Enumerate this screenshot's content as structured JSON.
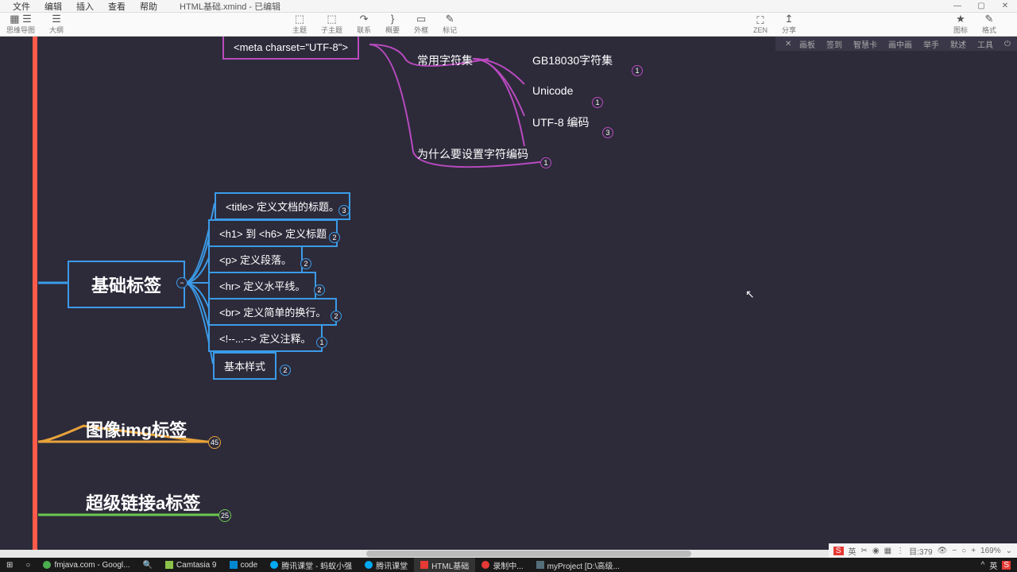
{
  "menu": [
    "文件",
    "编辑",
    "插入",
    "查看",
    "帮助"
  ],
  "window_title": "HTML基础.xmind - 已编辑",
  "toolbar": {
    "mindmap": "思维导图",
    "outline": "大纲",
    "topic": "主题",
    "subtopic": "子主题",
    "relation": "联系",
    "summary": "概要",
    "boundary": "外框",
    "marker": "标记",
    "zen": "ZEN",
    "share": "分享",
    "icons": "图标",
    "format": "格式"
  },
  "dark_tabs": [
    "画板",
    "签到",
    "智慧卡",
    "画中画",
    "举手",
    "默述",
    "工具"
  ],
  "nodes": {
    "meta": "<meta charset=\"UTF-8\">",
    "charset_common": "常用字符集",
    "gb18030": "GB18030字符集",
    "unicode": "Unicode",
    "utf8_encode": "UTF-8 编码",
    "why_charset": "为什么要设置字符编码",
    "base_tags": "基础标签",
    "title_tag": "<title> 定义文档的标题。",
    "h_tag": "<h1> 到 <h6> 定义标题",
    "p_tag": "<p> 定义段落。",
    "hr_tag": "<hr> 定义水平线。",
    "br_tag": "<br> 定义简单的换行。",
    "comment_tag": "<!--...--> 定义注释。",
    "basic_style": "基本样式",
    "img_tag": "图像img标签",
    "a_tag": "超级链接a标签"
  },
  "badges": {
    "gb18030": "1",
    "unicode": "1",
    "utf8": "3",
    "why": "1",
    "title": "3",
    "h": "2",
    "p": "2",
    "hr": "2",
    "br": "2",
    "comment": "1",
    "style": "2",
    "img": "45",
    "a": "25"
  },
  "status": {
    "zoom": "169%",
    "coord": "目:379"
  },
  "taskbar_items": [
    {
      "label": "fmjava.com - Googl...",
      "color": "#4caf50"
    },
    {
      "label": "",
      "color": "#ff5722"
    },
    {
      "label": "Camtasia 9",
      "color": "#8bc34a"
    },
    {
      "label": "code",
      "color": "#0288d1"
    },
    {
      "label": "腾讯课堂 - 蚂蚁小强",
      "color": "#ff9800"
    },
    {
      "label": "腾讯课堂",
      "color": "#ff9800"
    },
    {
      "label": "HTML基础",
      "color": "#e53935",
      "active": true
    },
    {
      "label": "录制中...",
      "color": "#e53935"
    },
    {
      "label": "myProject [D:\\高级...",
      "color": "#546e7a"
    }
  ],
  "ime": "英"
}
